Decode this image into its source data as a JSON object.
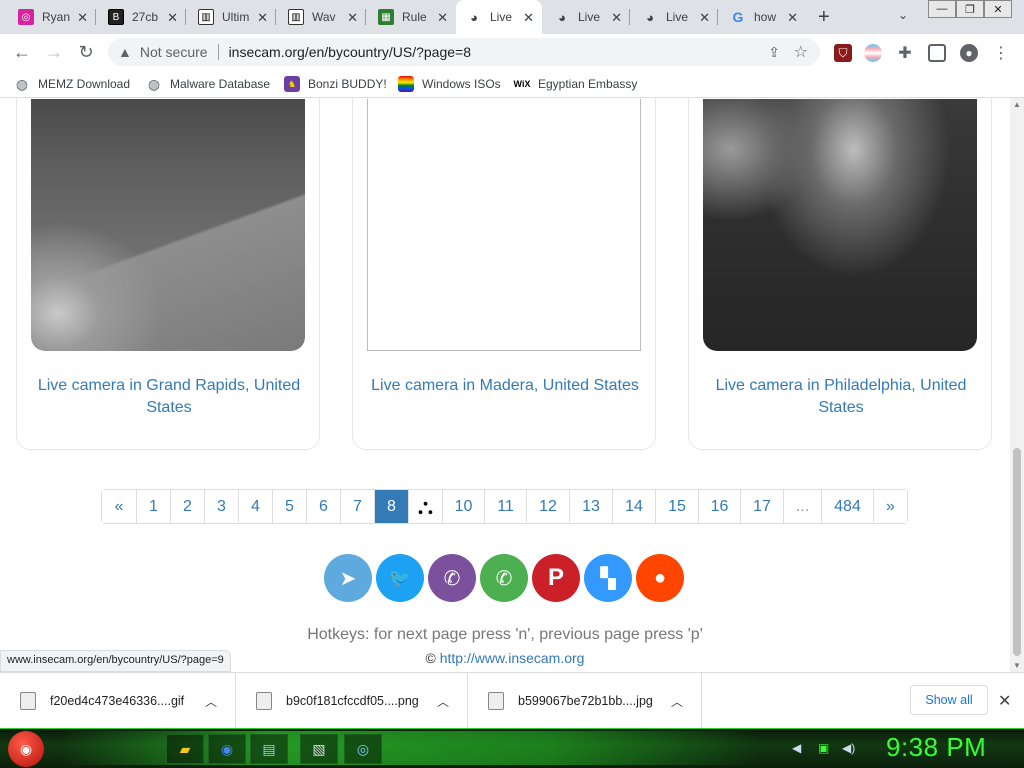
{
  "browser": {
    "tabs": [
      {
        "title": "Ryan",
        "favicon": "instagram-icon",
        "color": "#d6249f"
      },
      {
        "title": "27cb",
        "favicon": "b-icon",
        "color": "#222222"
      },
      {
        "title": "Ultim",
        "favicon": "piano-icon",
        "color": "#444444"
      },
      {
        "title": "Wav",
        "favicon": "piano-icon",
        "color": "#444444"
      },
      {
        "title": "Rule",
        "favicon": "circuit-icon",
        "color": "#2e7d32"
      },
      {
        "title": "Live",
        "favicon": "camera-icon",
        "color": "#555555"
      },
      {
        "title": "Live",
        "favicon": "camera-icon",
        "color": "#555555"
      },
      {
        "title": "Live",
        "favicon": "camera-icon",
        "color": "#555555"
      },
      {
        "title": "how",
        "favicon": "google-icon",
        "color": "#4285f4"
      }
    ],
    "new_tab": "+",
    "tab_search": "⌄",
    "window_buttons": [
      "—",
      "❐",
      "✕"
    ]
  },
  "toolbar": {
    "back": "←",
    "forward": "→",
    "reload": "↻",
    "security_label": "Not secure",
    "url": "insecam.org/en/bycountry/US/?page=8"
  },
  "bookmarks": [
    {
      "label": "MEMZ Download",
      "icon": "globe-icon"
    },
    {
      "label": "Malware Database",
      "icon": "globe-icon"
    },
    {
      "label": "Bonzi BUDDY!",
      "icon": "bonzi-icon"
    },
    {
      "label": "Windows ISOs",
      "icon": "rainbow-flag-icon"
    },
    {
      "label": "Egyptian Embassy",
      "icon": "wix-icon"
    }
  ],
  "cameras": [
    {
      "caption": "Live camera in Grand Rapids, United States"
    },
    {
      "caption": "Live camera in Madera, United States"
    },
    {
      "caption": "Live camera in Philadelphia, United States"
    }
  ],
  "pagination": {
    "items": [
      "«",
      "1",
      "2",
      "3",
      "4",
      "5",
      "6",
      "7",
      "8",
      "",
      "10",
      "11",
      "12",
      "13",
      "14",
      "15",
      "16",
      "17",
      "...",
      "484",
      "»"
    ],
    "active": "8"
  },
  "social": [
    {
      "name": "telegram",
      "glyph": "➤",
      "color": "#5ea9dd"
    },
    {
      "name": "twitter",
      "glyph": "🐦",
      "color": "#1da1f2"
    },
    {
      "name": "viber",
      "glyph": "✆",
      "color": "#7b519d"
    },
    {
      "name": "whatsapp",
      "glyph": "✆",
      "color": "#4caf50"
    },
    {
      "name": "pinterest",
      "glyph": "P",
      "color": "#cb2027"
    },
    {
      "name": "delicious",
      "glyph": "▚",
      "color": "#3399ff"
    },
    {
      "name": "reddit",
      "glyph": "●",
      "color": "#ff4500"
    }
  ],
  "footer": {
    "hotkeys": "Hotkeys: for next page press 'n', previous page press 'p'",
    "copyright_symbol": "©",
    "link": "http://www.insecam.org"
  },
  "status_url": "www.insecam.org/en/bycountry/US/?page=9",
  "downloads": {
    "items": [
      {
        "name": "f20ed4c473e46336....gif"
      },
      {
        "name": "b9c0f181cfccdf05....png"
      },
      {
        "name": "b599067be72b1bb....jpg"
      }
    ],
    "show_all": "Show all",
    "close": "✕"
  },
  "taskbar": {
    "clock": "9:38 PM"
  }
}
